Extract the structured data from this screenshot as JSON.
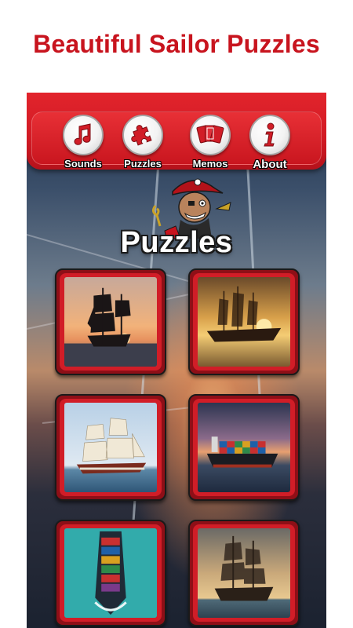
{
  "promo": {
    "title": "Beautiful Sailor Puzzles"
  },
  "nav": {
    "items": [
      {
        "label": "Sounds",
        "icon": "music-note-icon"
      },
      {
        "label": "Puzzles",
        "icon": "puzzle-piece-icon"
      },
      {
        "label": "Memos",
        "icon": "cards-icon"
      },
      {
        "label": "About",
        "icon": "info-icon"
      }
    ]
  },
  "main": {
    "title": "Puzzles"
  },
  "puzzles": [
    {
      "name": "pirate-ship-sunset"
    },
    {
      "name": "galleon-golden-sea"
    },
    {
      "name": "tall-ship-sails"
    },
    {
      "name": "container-ship-sunset"
    },
    {
      "name": "container-ship-aerial"
    },
    {
      "name": "pirate-ship-clouds"
    }
  ],
  "colors": {
    "accent": "#c8141e",
    "frame": "#d11d27",
    "frame_dark": "#8e0f17"
  }
}
